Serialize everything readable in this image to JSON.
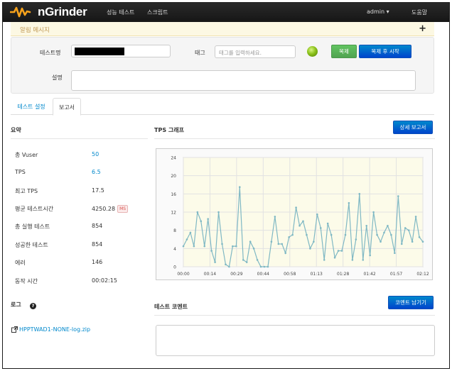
{
  "navbar": {
    "brand": "nGrinder",
    "menu": [
      "성능 테스트",
      "스크립트"
    ],
    "user": "admin ▾",
    "help": "도움말"
  },
  "message_bar": {
    "title": "알림 메시지",
    "toggle": "+"
  },
  "form": {
    "test_name_label": "테스트명",
    "tag_label": "태그",
    "tag_placeholder": "태그를 입력하세요.",
    "clone_button": "복제",
    "clone_start_button": "복제 후 시작",
    "description_label": "설명"
  },
  "tabs": [
    {
      "label": "테스트 설정",
      "active": false
    },
    {
      "label": "보고서",
      "active": true
    }
  ],
  "summary": {
    "heading": "요약",
    "rows": [
      {
        "label": "총 Vuser",
        "value": "50",
        "link": true
      },
      {
        "label": "TPS",
        "value": "6.5",
        "link": true
      },
      {
        "label": "최고 TPS",
        "value": "17.5",
        "link": false
      },
      {
        "label": "평균 테스트시간",
        "value": "4250.28",
        "unit": "MS",
        "link": false
      },
      {
        "label": "총 실행 테스트",
        "value": "854",
        "link": false
      },
      {
        "label": "성공한 테스트",
        "value": "854",
        "link": false
      },
      {
        "label": "에러",
        "value": "146",
        "link": false
      },
      {
        "label": "동작 시간",
        "value": "00:02:15",
        "link": false
      }
    ]
  },
  "tps_panel": {
    "heading": "TPS 그래프",
    "detail_button": "상세 보고서"
  },
  "log": {
    "heading": "로그",
    "help_icon": "?",
    "file": "HPPTWAD1-NONE-log.zip"
  },
  "comment": {
    "heading": "테스트 코멘트",
    "button": "코멘트 남기기"
  },
  "chart_data": {
    "type": "line",
    "title": "",
    "xlabel": "",
    "ylabel": "",
    "ylim": [
      0,
      24
    ],
    "yticks": [
      0,
      4,
      8,
      12,
      16,
      20,
      24
    ],
    "xticks": [
      "00:00",
      "00:14",
      "00:29",
      "00:44",
      "00:58",
      "01:13",
      "01:28",
      "01:42",
      "01:57",
      "02:12"
    ],
    "grid": true,
    "line_color": "#7fb8c4",
    "point_color": "#7fb8c4",
    "values": [
      4.5,
      6,
      7.5,
      4.5,
      12,
      10,
      4.5,
      10.5,
      3.5,
      1,
      12,
      5,
      0.5,
      0,
      4.5,
      4.5,
      17.5,
      1.5,
      1,
      5.5,
      4,
      1.5,
      0,
      0,
      0,
      5.5,
      11,
      5,
      5,
      3,
      6.5,
      7,
      13,
      9,
      10,
      7,
      4,
      5.5,
      11.5,
      8.5,
      1.5,
      9.5,
      7,
      2,
      3.5,
      3.5,
      7,
      14,
      1.5,
      6,
      16,
      1.5,
      9,
      2.5,
      12,
      7,
      5.5,
      7.5,
      9,
      7,
      3,
      15.5,
      5,
      8.5,
      8,
      5.5,
      11,
      6.5,
      5.5
    ]
  }
}
